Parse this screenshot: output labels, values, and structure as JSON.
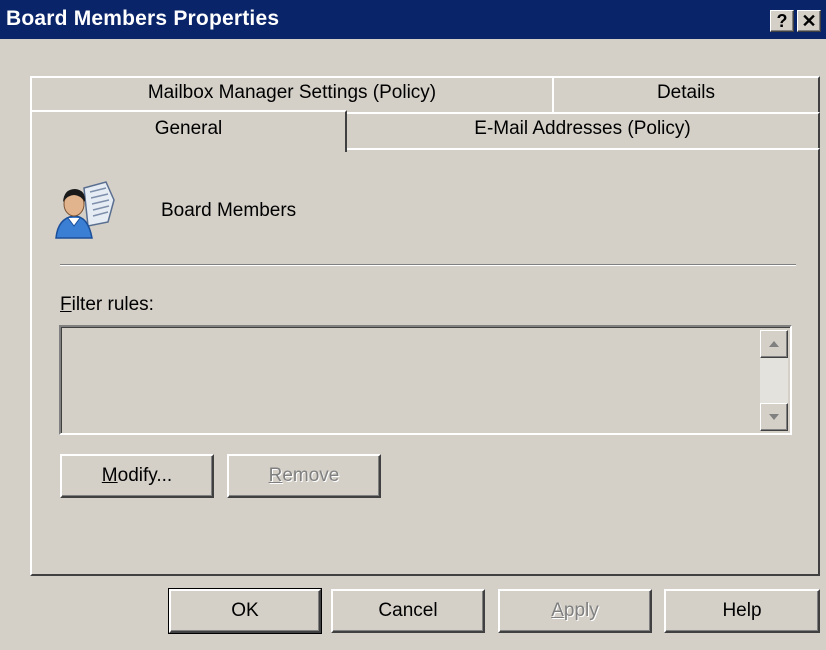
{
  "window": {
    "title": "Board Members Properties",
    "help_button": "?",
    "close_button": "✕"
  },
  "tabs": {
    "row_back": [
      {
        "label": "Mailbox Manager Settings (Policy)"
      },
      {
        "label": "Details"
      }
    ],
    "row_front": [
      {
        "label": "General",
        "selected": true
      },
      {
        "label": "E-Mail Addresses (Policy)"
      }
    ]
  },
  "general": {
    "group_name": "Board Members",
    "filter_rules_label": {
      "accel": "F",
      "rest": "ilter rules:"
    },
    "filter_rules_value": "",
    "modify_button": {
      "accel": "M",
      "rest": "odify..."
    },
    "remove_button": {
      "accel": "R",
      "rest": "emove",
      "enabled": false
    }
  },
  "footer": {
    "ok": "OK",
    "cancel": "Cancel",
    "apply": {
      "accel": "A",
      "rest": "pply",
      "enabled": false
    },
    "help": "Help"
  },
  "colors": {
    "title_bar": "#0a246a",
    "face": "#d4d0c8"
  }
}
